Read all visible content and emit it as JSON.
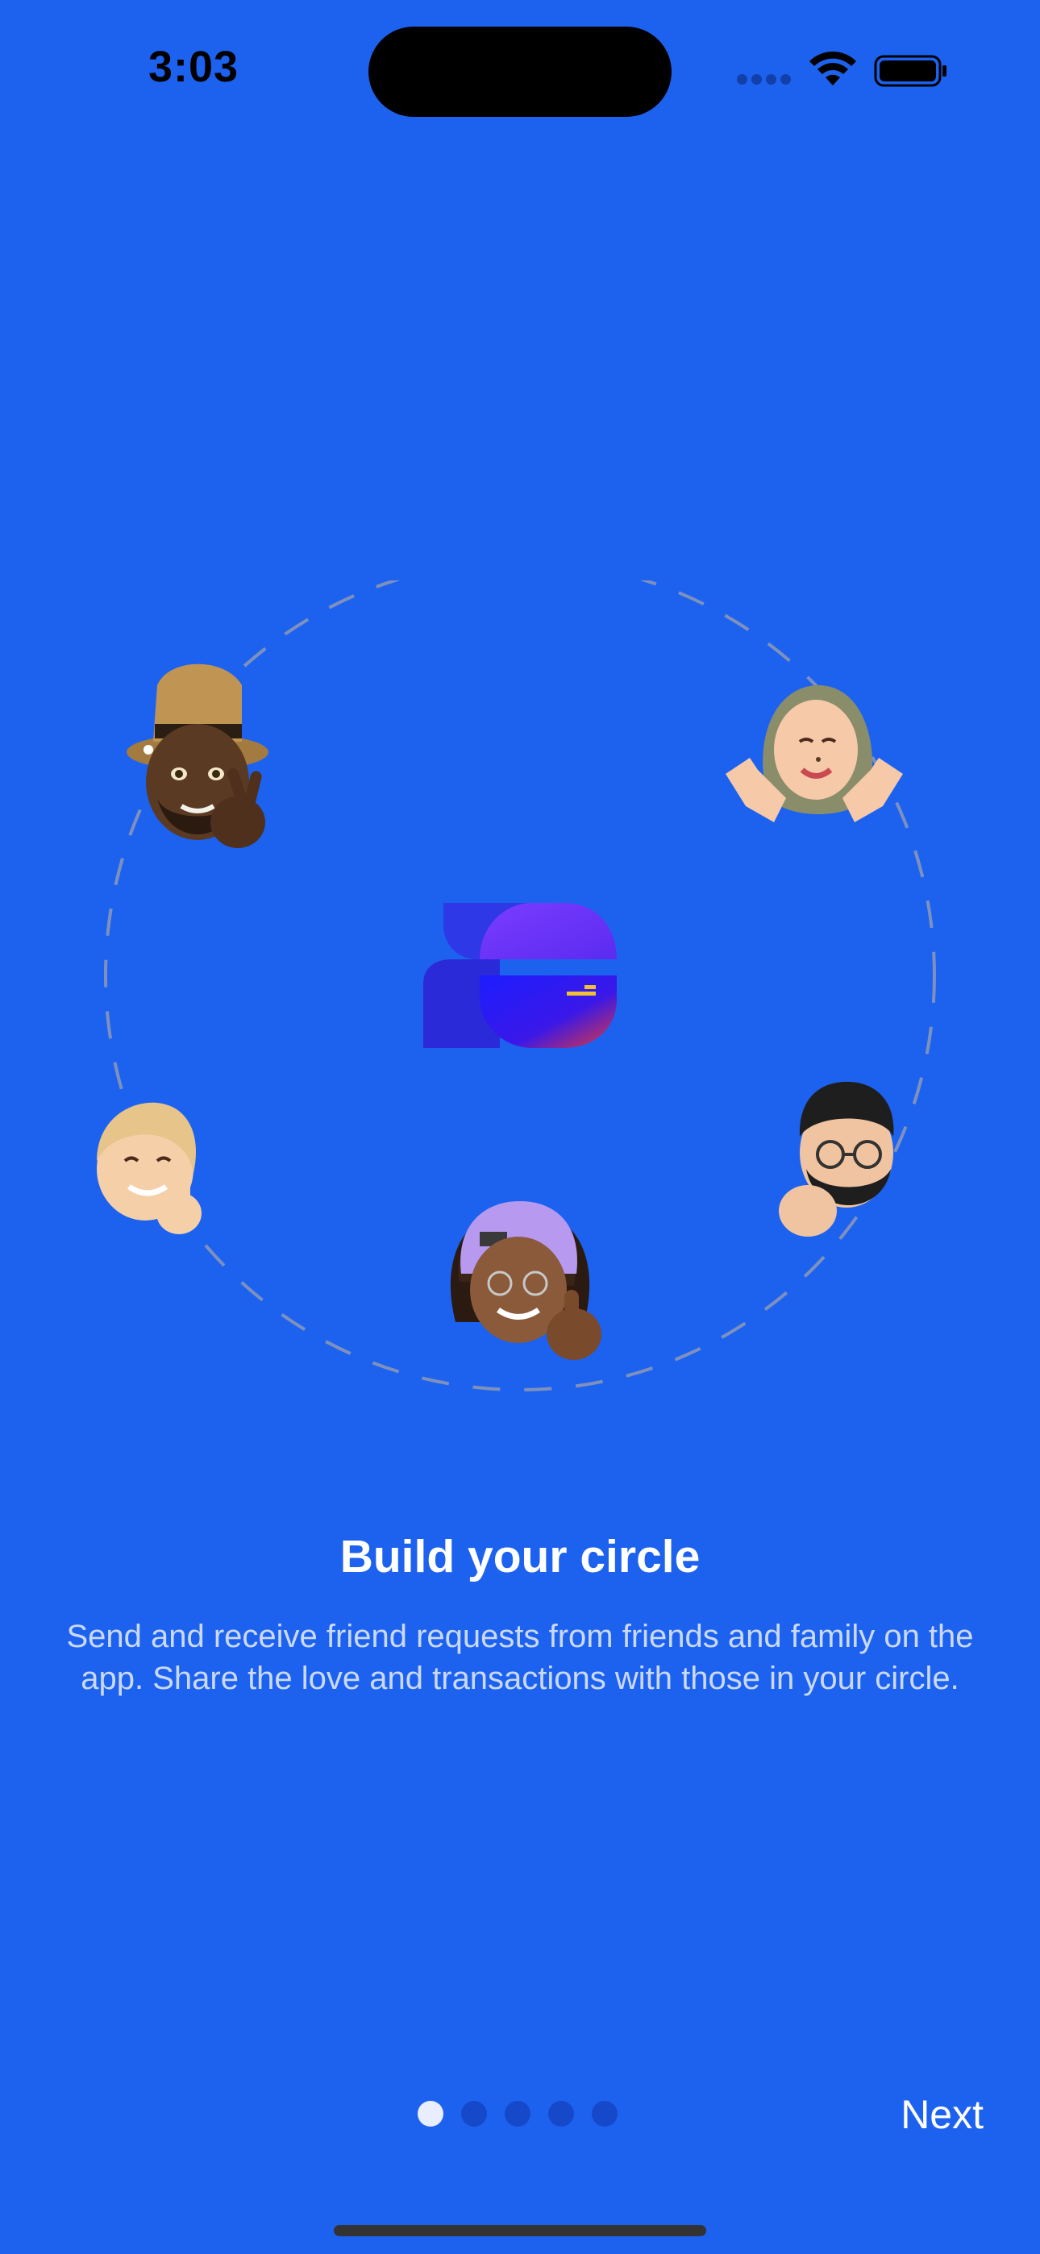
{
  "status_bar": {
    "time": "3:03",
    "signal_icon": "cellular-signal-icon",
    "wifi_icon": "wifi-icon",
    "battery_icon": "battery-icon"
  },
  "illustration": {
    "logo_icon": "app-logo-icon",
    "avatars": [
      {
        "name": "memoji-hat-peace-icon"
      },
      {
        "name": "memoji-hijab-wave-icon"
      },
      {
        "name": "memoji-crossed-fingers-icon"
      },
      {
        "name": "memoji-glasses-fist-icon"
      },
      {
        "name": "memoji-cap-thumbsup-icon"
      }
    ]
  },
  "onboarding": {
    "title": "Build your circle",
    "description": "Send and receive friend requests from friends and family on the app. Share the love and transactions with those in your circle."
  },
  "pager": {
    "total_pages": 5,
    "current_page": 1
  },
  "next_label": "Next",
  "colors": {
    "background": "#1D62EE",
    "dot_active": "#E8EEFF",
    "dot_inactive": "#1649C9"
  }
}
